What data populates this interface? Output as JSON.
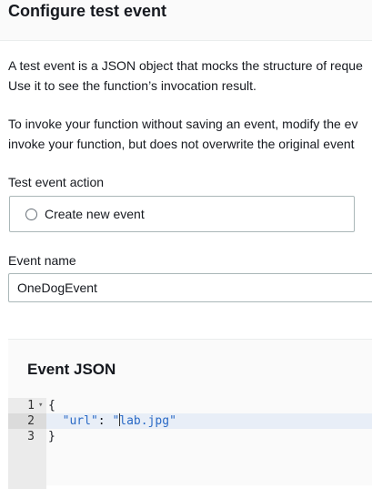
{
  "header": {
    "title": "Configure test event"
  },
  "description": {
    "line1": "A test event is a JSON object that mocks the structure of reque",
    "line2": "Use it to see the function’s invocation result.",
    "line3": "To invoke your function without saving an event, modify the ev",
    "line4": "invoke your function, but does not overwrite the original event"
  },
  "test_event_action": {
    "label": "Test event action",
    "option_label": "Create new event"
  },
  "event_name": {
    "label": "Event name",
    "value": "OneDogEvent"
  },
  "event_json": {
    "title": "Event JSON",
    "lines": [
      {
        "number": "1",
        "text": "{"
      },
      {
        "number": "2",
        "key": "\"url\"",
        "sep": ": ",
        "value_before_cursor": "\"",
        "value_after_cursor": "lab.jpg\""
      },
      {
        "number": "3",
        "text": "}"
      }
    ]
  }
}
